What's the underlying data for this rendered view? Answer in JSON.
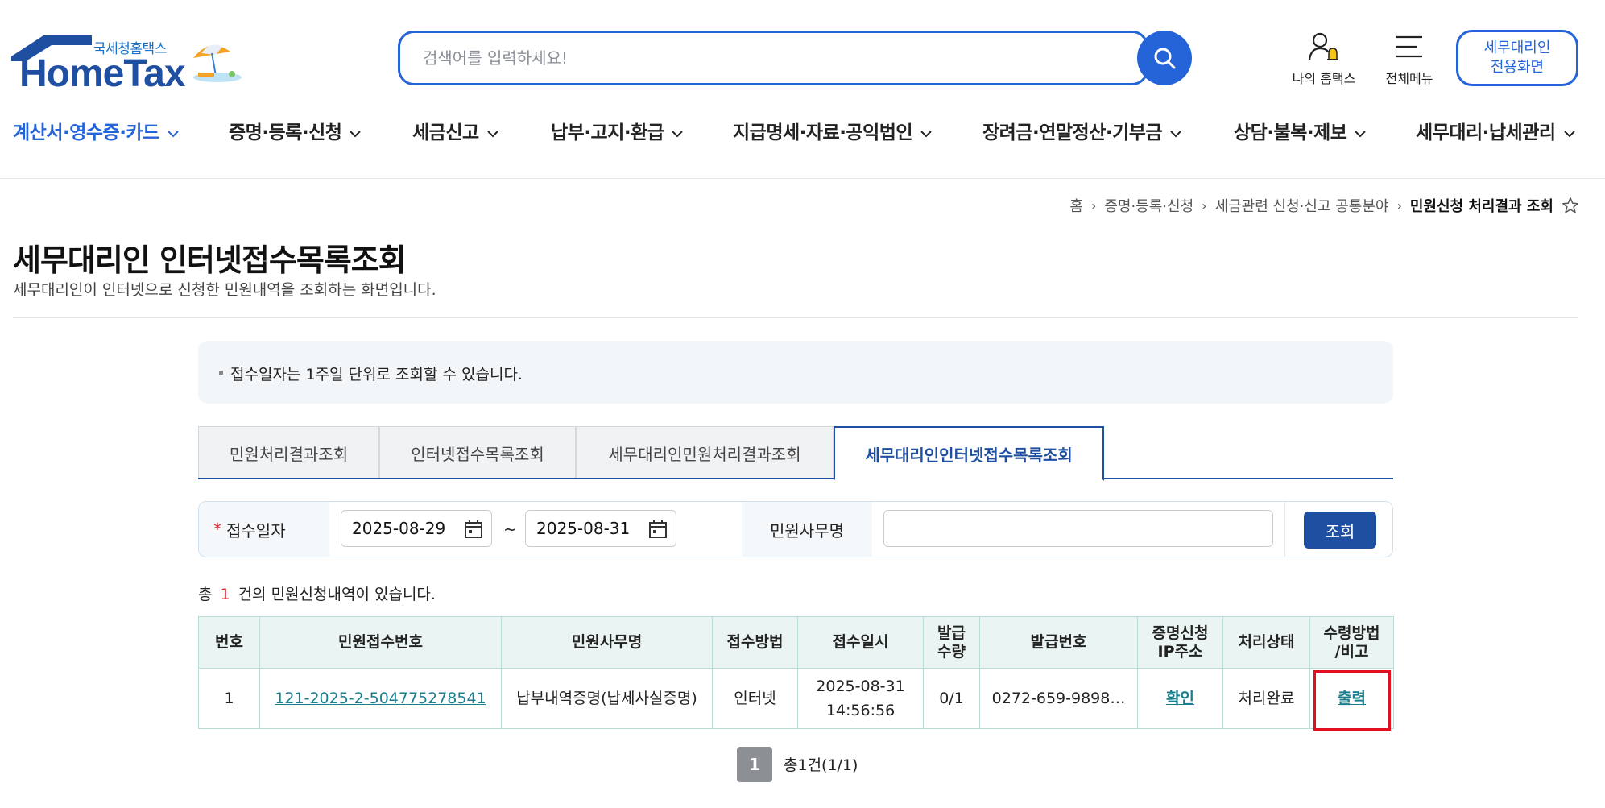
{
  "logo": {
    "sub": "국세청홈택스",
    "main": "HomeTax"
  },
  "search": {
    "placeholder": "검색어를 입력하세요!"
  },
  "util": {
    "my": "나의 홈택스",
    "menu": "전체메뉴",
    "agent_line1": "세무대리인",
    "agent_line2": "전용화면"
  },
  "nav": [
    {
      "label": "계산서·영수증·카드",
      "active": true
    },
    {
      "label": "증명·등록·신청"
    },
    {
      "label": "세금신고"
    },
    {
      "label": "납부·고지·환급"
    },
    {
      "label": "지급명세·자료·공익법인"
    },
    {
      "label": "장려금·연말정산·기부금"
    },
    {
      "label": "상담·불복·제보"
    },
    {
      "label": "세무대리·납세관리"
    }
  ],
  "breadcrumb": [
    "홈",
    "증명·등록·신청",
    "세금관련 신청·신고 공통분야",
    "민원신청 처리결과 조회"
  ],
  "page": {
    "title": "세무대리인 인터넷접수목록조회",
    "desc": "세무대리인이 인터넷으로 신청한 민원내역을 조회하는 화면입니다."
  },
  "notice": "접수일자는 1주일 단위로 조회할 수 있습니다.",
  "tabs": [
    "민원처리결과조회",
    "인터넷접수목록조회",
    "세무대리인민원처리결과조회",
    "세무대리인인터넷접수목록조회"
  ],
  "form": {
    "date_label": "접수일자",
    "required_mark": "*",
    "date_from": "2025-08-29",
    "tilde": "~",
    "date_to": "2025-08-31",
    "name_label": "민원사무명",
    "name_value": "",
    "query_label": "조회"
  },
  "count": {
    "prefix": "총",
    "value": "1",
    "suffix": "건의 민원신청내역이 있습니다."
  },
  "table": {
    "headers": [
      "번호",
      "민원접수번호",
      "민원사무명",
      "접수방법",
      "접수일시",
      "발급수량",
      "발급번호",
      "증명신청IP주소",
      "처리상태",
      "수령방법/비고"
    ],
    "header_lines": {
      "qty": [
        "발급",
        "수량"
      ],
      "ip": [
        "증명신청",
        "IP주소"
      ],
      "recv": [
        "수령방법",
        "/비고"
      ]
    },
    "rows": [
      {
        "no": "1",
        "receipt_no": "121-2025-2-504775278541",
        "name": "납부내역증명(납세사실증명)",
        "method": "인터넷",
        "date": "2025-08-31",
        "time": "14:56:56",
        "qty": "0/1",
        "issue_no": "0272-659-9898…",
        "ip": "확인",
        "status": "처리완료",
        "recv": "출력"
      }
    ]
  },
  "pagination": {
    "current": "1",
    "info": "총1건(1/1)"
  },
  "colors": {
    "primary": "#2563d8",
    "navy": "#1f4fa0",
    "teal_link": "#1a7f8e",
    "red": "#e0202f"
  }
}
